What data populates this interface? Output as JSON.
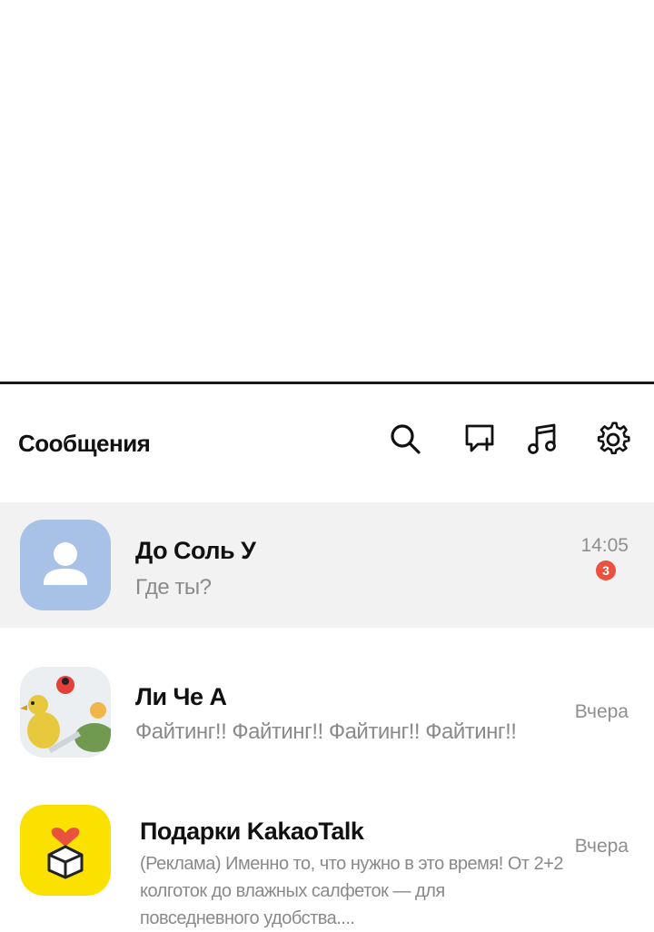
{
  "header": {
    "title": "Сообщения",
    "icons": [
      "search-icon",
      "new-chat-icon",
      "music-icon",
      "gear-icon"
    ]
  },
  "chats": [
    {
      "name": "До Соль У",
      "preview": "Где ты?",
      "time": "14:05",
      "unread": "3",
      "avatar": "default-profile-icon"
    },
    {
      "name": "Ли Че А",
      "preview": "Файтинг!! Файтинг!! Файтинг!! Файтинг!!",
      "time": "Вчера",
      "avatar": "photo-ducks"
    },
    {
      "name": "Подарки KakaoTalk",
      "preview": "(Реклама) Именно то, что нужно в это время! От 2+2 колготок до влажных салфеток — для повседневного удобства....",
      "time": "Вчера",
      "avatar": "gift-box-icon"
    }
  ],
  "colors": {
    "active_row": "#f2f2f2",
    "default_avatar": "#a8c1e6",
    "gift_avatar": "#fbe100",
    "badge": "#e8523f"
  }
}
